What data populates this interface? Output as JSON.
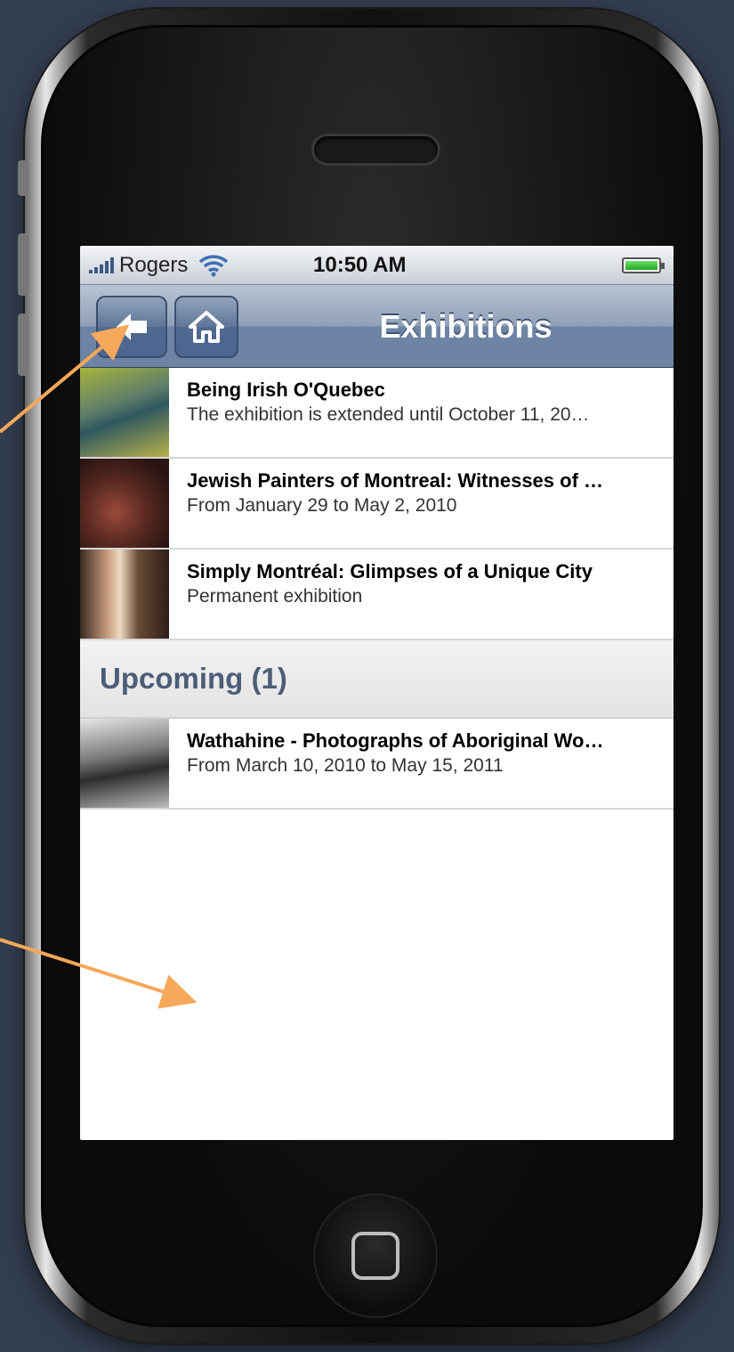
{
  "status_bar": {
    "carrier": "Rogers",
    "time": "10:50 AM"
  },
  "nav_bar": {
    "title": "Exhibitions",
    "back_icon": "back-arrow-icon",
    "home_icon": "home-icon"
  },
  "current_items": [
    {
      "title": "Being Irish O'Quebec",
      "subtitle": "The exhibition is extended until October 11, 20…"
    },
    {
      "title": "Jewish Painters of Montreal: Witnesses of …",
      "subtitle": "From January 29 to May 2, 2010"
    },
    {
      "title": "Simply Montréal: Glimpses of a Unique City",
      "subtitle": "Permanent exhibition"
    }
  ],
  "upcoming": {
    "header": "Upcoming (1)",
    "items": [
      {
        "title": "Wathahine - Photographs of Aboriginal Wo…",
        "subtitle": "From March 10, 2010 to May 15, 2011"
      }
    ]
  },
  "colors": {
    "background": "#323d4f",
    "nav_bar": "#6d84a4",
    "section_header_text": "#4c5d78",
    "annotation_arrow": "#f6a85b"
  }
}
